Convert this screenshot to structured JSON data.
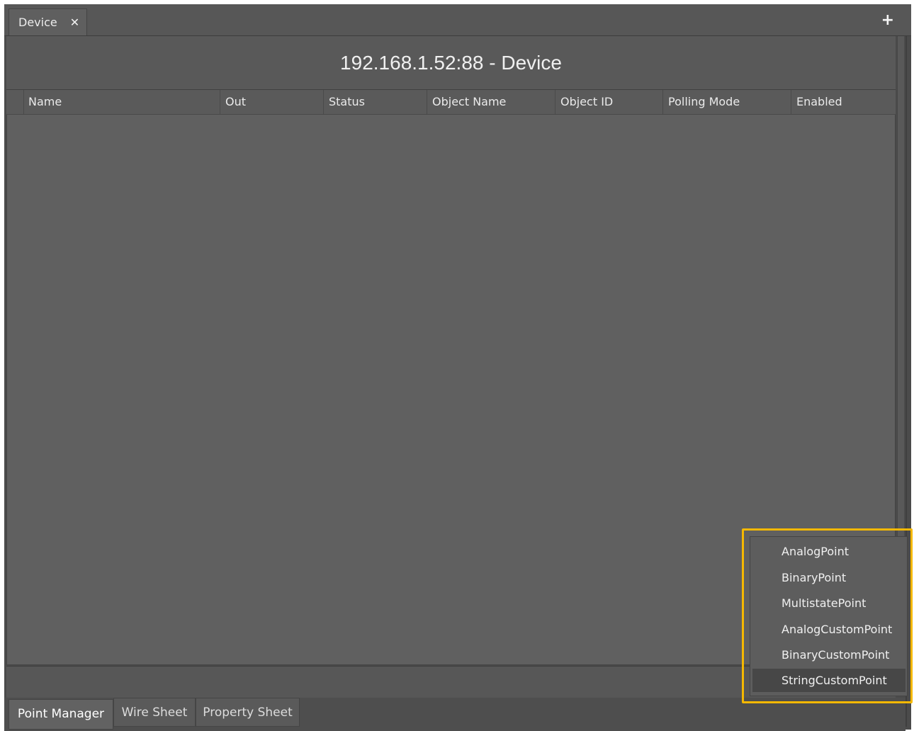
{
  "tab": {
    "label": "Device",
    "close_icon": "close-icon"
  },
  "toolbar": {
    "add_icon": "plus-icon"
  },
  "view": {
    "title": "192.168.1.52:88 - Device"
  },
  "table": {
    "columns": [
      "Name",
      "Out",
      "Status",
      "Object Name",
      "Object ID",
      "Polling Mode",
      "Enabled"
    ],
    "rows": []
  },
  "context_menu": {
    "items": [
      "AnalogPoint",
      "BinaryPoint",
      "MultistatePoint",
      "AnalogCustomPoint",
      "BinaryCustomPoint",
      "StringCustomPoint"
    ],
    "selected": "StringCustomPoint",
    "highlight_color": "#f5b800"
  },
  "bottom_tabs": [
    "Point Manager",
    "Wire Sheet",
    "Property Sheet"
  ],
  "active_bottom_tab": "Point Manager"
}
